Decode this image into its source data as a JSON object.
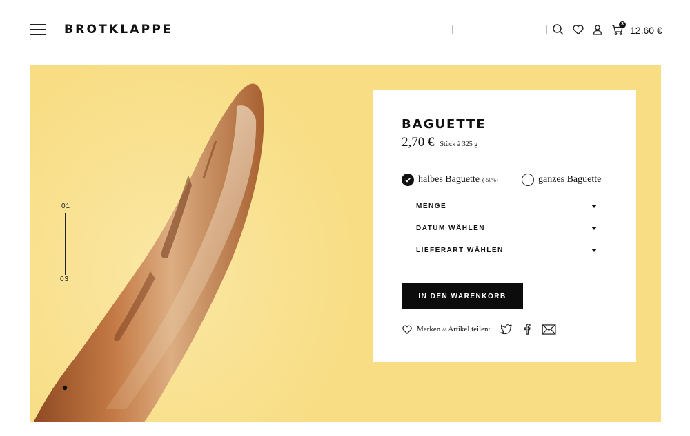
{
  "header": {
    "brand": "BROTKLAPPE",
    "search": {
      "value": "",
      "placeholder": ""
    },
    "icons": [
      "menu-icon",
      "search-icon",
      "heart-icon",
      "user-icon",
      "cart-icon"
    ],
    "cart_count": "3",
    "cart_total": "12,60 €"
  },
  "hero": {
    "background_color": "#f8dd84",
    "slide_current": "01",
    "slide_total": "03"
  },
  "product": {
    "name": "BAGUETTE",
    "price": "2,70 €",
    "unit": "Stück à 325 g",
    "options": [
      {
        "label": "halbes Baguette",
        "note": "(-50%)",
        "selected": true
      },
      {
        "label": "ganzes Baguette",
        "note": "",
        "selected": false
      }
    ],
    "selects": [
      {
        "label": "MENGE"
      },
      {
        "label": "DATUM WÄHLEN"
      },
      {
        "label": "LIEFERART WÄHLEN"
      }
    ],
    "cta": "IN DEN WARENKORB",
    "share_text": "Merken // Artikel teilen:",
    "share_icons": [
      "heart-icon",
      "twitter-icon",
      "facebook-icon",
      "mail-icon"
    ]
  },
  "colors": {
    "accent_yellow": "#f8dd84",
    "button_black": "#0c0c0c",
    "text": "#111111"
  }
}
